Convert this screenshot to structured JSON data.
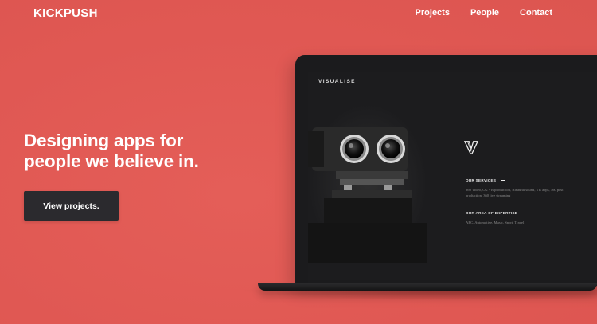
{
  "header": {
    "logo": "KICKPUSH",
    "nav": [
      {
        "label": "Projects"
      },
      {
        "label": "People"
      },
      {
        "label": "Contact"
      }
    ]
  },
  "hero": {
    "headline_line1": "Designing apps for",
    "headline_line2": "people we believe in.",
    "cta_label": "View projects."
  },
  "screen": {
    "brand": "VISUALISE",
    "services_heading": "OUR SERVICES",
    "services_text": "360 Video, CG VR production, Binaural sound, VR apps, 360 post production, 360 live streaming",
    "expertise_heading": "OUR AREA OF EXPERTISE",
    "expertise_text": "AEC, Automotive, Music, Sport, Travel"
  },
  "colors": {
    "background": "#e25a55",
    "button": "#2b2a2e",
    "text": "#ffffff",
    "laptop": "#1b1b1d"
  },
  "icons": [
    "search-icon",
    "visualise-v-logo-icon"
  ]
}
